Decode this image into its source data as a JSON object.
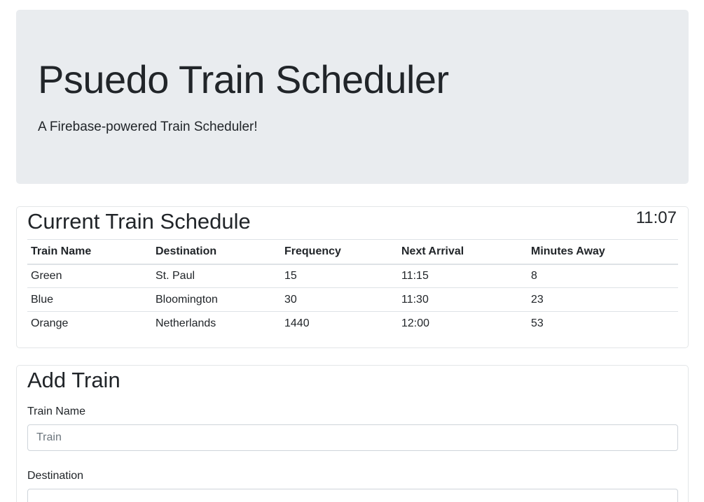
{
  "jumbotron": {
    "title": "Psuedo Train Scheduler",
    "subtitle": "A Firebase-powered Train Scheduler!"
  },
  "schedule": {
    "heading": "Current Train Schedule",
    "clock": "11:07",
    "columns": [
      "Train Name",
      "Destination",
      "Frequency",
      "Next Arrival",
      "Minutes Away"
    ],
    "rows": [
      [
        "Green",
        "St. Paul",
        "15",
        "11:15",
        "8"
      ],
      [
        "Blue",
        "Bloomington",
        "30",
        "11:30",
        "23"
      ],
      [
        "Orange",
        "Netherlands",
        "1440",
        "12:00",
        "53"
      ]
    ]
  },
  "add_train": {
    "heading": "Add Train",
    "train_name_label": "Train Name",
    "train_name_placeholder": "Train",
    "destination_label": "Destination",
    "destination_placeholder": ""
  }
}
